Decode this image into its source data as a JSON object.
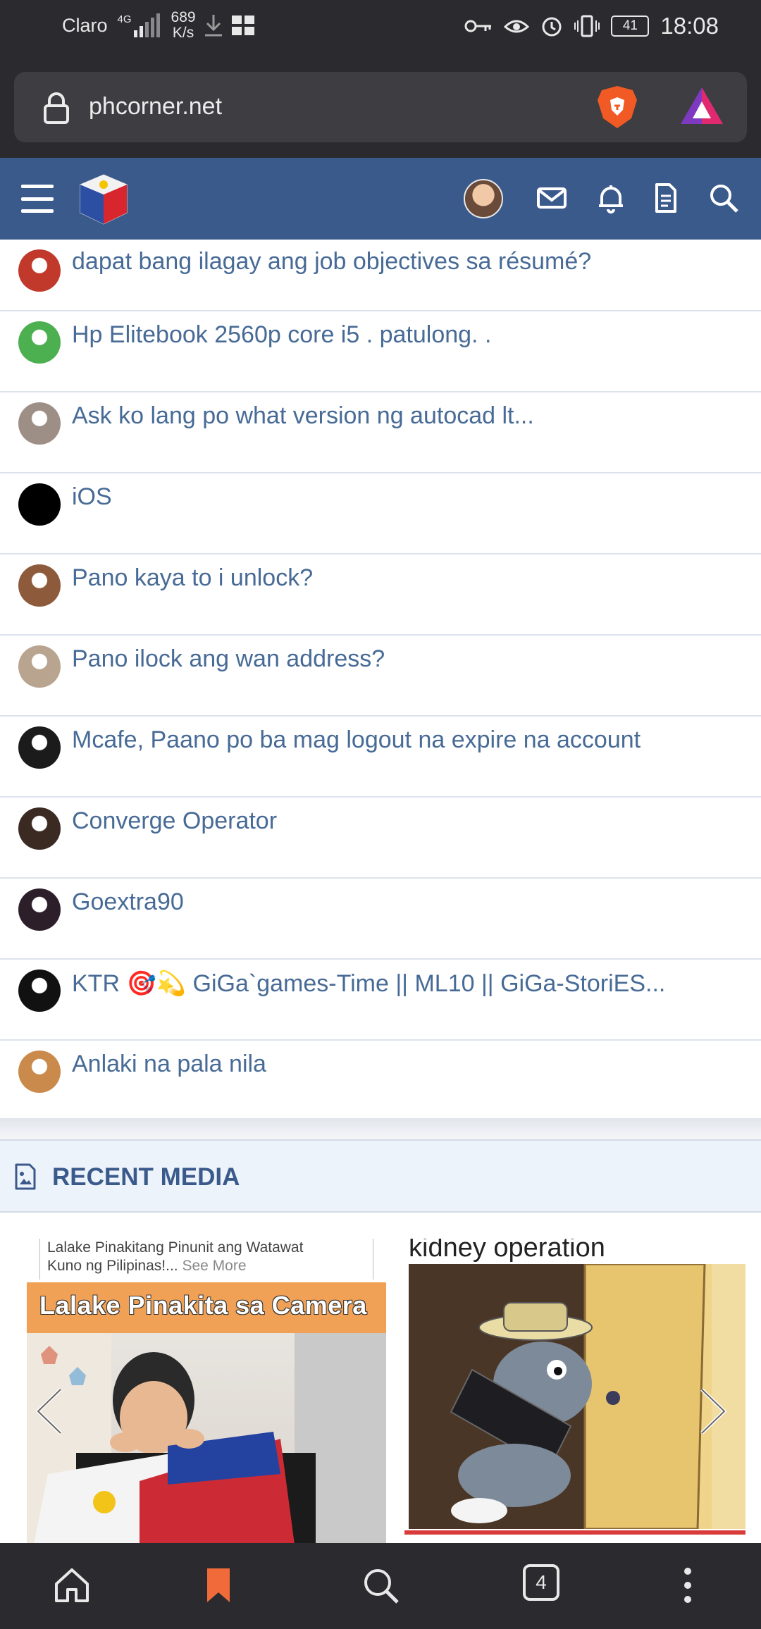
{
  "status_bar": {
    "carrier": "Claro",
    "network": "4G",
    "speed_value": "689",
    "speed_unit": "K/s",
    "battery": "41",
    "time": "18:08"
  },
  "browser": {
    "url": "phcorner.net",
    "tab_count": "4"
  },
  "site_header": {
    "icons": [
      "menu-icon",
      "site-logo",
      "user-avatar",
      "inbox-icon",
      "bell-icon",
      "document-icon",
      "search-icon"
    ],
    "brand_color": "#3b5a8c"
  },
  "threads": [
    {
      "title": "dapat bang ilagay ang job objectives sa résumé?",
      "avatar_color": "#c0392b"
    },
    {
      "title": "Hp Elitebook 2560p core i5 . patulong. .",
      "avatar_color": "#4caf50"
    },
    {
      "title": "Ask ko lang po what version ng autocad lt...",
      "avatar_color": "#9e8f86"
    },
    {
      "title": "iOS",
      "avatar_color": "#000000"
    },
    {
      "title": "Pano kaya to i unlock?",
      "avatar_color": "#8d5a3c"
    },
    {
      "title": "Pano ilock ang wan address?",
      "avatar_color": "#b8a48f"
    },
    {
      "title": "Mcafe, Paano po ba mag logout na expire na account",
      "avatar_color": "#1b1b1b"
    },
    {
      "title": "Converge Operator",
      "avatar_color": "#3a2a22"
    },
    {
      "title": "Goextra90",
      "avatar_color": "#2c1f2a"
    },
    {
      "title": "KTR 🎯💫 GiGa`games-Time || ML10 || GiGa-StoriES...",
      "avatar_color": "#111111"
    },
    {
      "title": "Anlaki na pala nila",
      "avatar_color": "#c98a4b"
    }
  ],
  "recent_media": {
    "title": "RECENT MEDIA",
    "item1": {
      "caption_line1": "Lalake Pinakitang Pinunit ang Watawat",
      "caption_line2": "Kuno ng Pilipinas!...",
      "see_more": "See More",
      "banner": "Lalake Pinakita sa Camera"
    },
    "item2": {
      "caption": "kidney operation"
    }
  }
}
